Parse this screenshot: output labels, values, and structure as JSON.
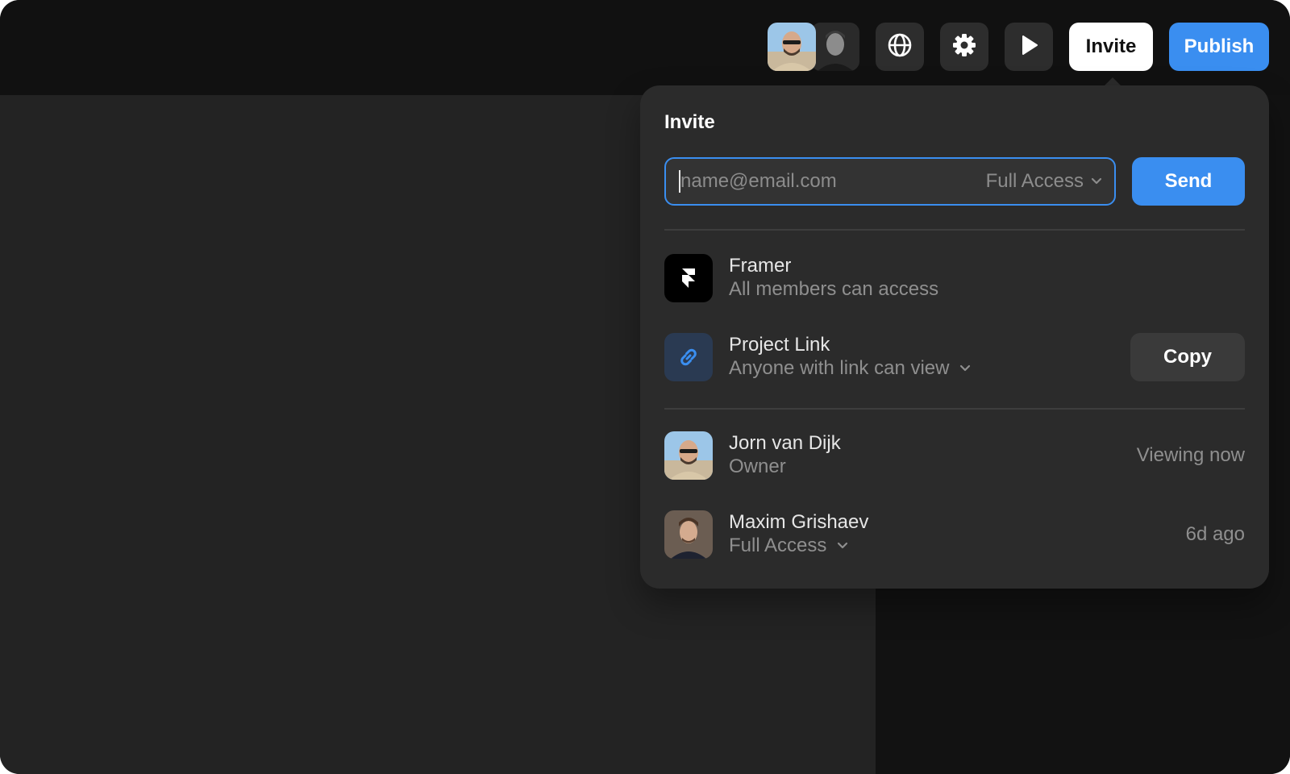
{
  "toolbar": {
    "avatars": [
      {
        "name": "Jorn van Dijk avatar"
      },
      {
        "name": "Maxim Grishaev avatar"
      }
    ],
    "icons": [
      "globe-icon",
      "gear-icon",
      "play-icon"
    ],
    "invite_label": "Invite",
    "publish_label": "Publish"
  },
  "popover": {
    "title": "Invite",
    "email": {
      "placeholder": "name@email.com",
      "value": "",
      "access": "Full Access"
    },
    "send_label": "Send",
    "workspace": {
      "name": "Framer",
      "sub": "All members can access"
    },
    "link": {
      "name": "Project Link",
      "sub": "Anyone with link can view",
      "copy_label": "Copy"
    },
    "members": [
      {
        "name": "Jorn van Dijk",
        "role": "Owner",
        "status": "Viewing now"
      },
      {
        "name": "Maxim Grishaev",
        "role": "Full Access",
        "status": "6d ago"
      }
    ]
  },
  "colors": {
    "accent": "#3a8ef0",
    "window_bg": "#111111",
    "canvas_bg": "#232323",
    "popover_bg": "#2b2b2b"
  }
}
